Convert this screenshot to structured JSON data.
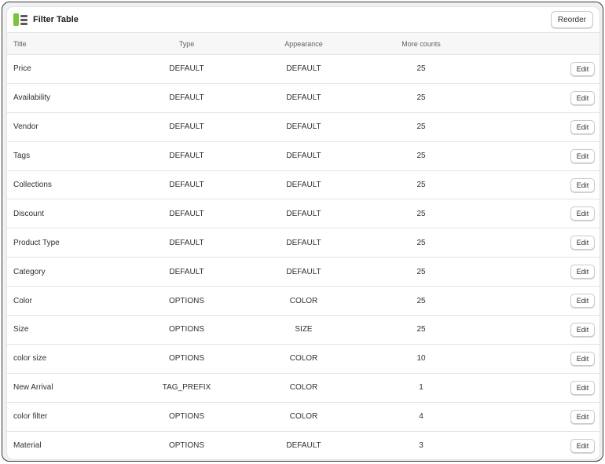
{
  "header": {
    "title": "Filter Table",
    "reorder_label": "Reorder",
    "icon": "filter-table-logo-icon"
  },
  "columns": {
    "title": "Title",
    "type": "Type",
    "appearance": "Appearance",
    "more_counts": "More counts"
  },
  "edit_label": "Edit",
  "colors": {
    "accent": "#7cc23b",
    "border": "#e3e3e3",
    "header_bg": "#f7f7f7"
  },
  "rows": [
    {
      "title": "Price",
      "type": "DEFAULT",
      "appearance": "DEFAULT",
      "more_counts": "25"
    },
    {
      "title": "Availability",
      "type": "DEFAULT",
      "appearance": "DEFAULT",
      "more_counts": "25"
    },
    {
      "title": "Vendor",
      "type": "DEFAULT",
      "appearance": "DEFAULT",
      "more_counts": "25"
    },
    {
      "title": "Tags",
      "type": "DEFAULT",
      "appearance": "DEFAULT",
      "more_counts": "25"
    },
    {
      "title": "Collections",
      "type": "DEFAULT",
      "appearance": "DEFAULT",
      "more_counts": "25"
    },
    {
      "title": "Discount",
      "type": "DEFAULT",
      "appearance": "DEFAULT",
      "more_counts": "25"
    },
    {
      "title": "Product Type",
      "type": "DEFAULT",
      "appearance": "DEFAULT",
      "more_counts": "25"
    },
    {
      "title": "Category",
      "type": "DEFAULT",
      "appearance": "DEFAULT",
      "more_counts": "25"
    },
    {
      "title": "Color",
      "type": "OPTIONS",
      "appearance": "COLOR",
      "more_counts": "25"
    },
    {
      "title": "Size",
      "type": "OPTIONS",
      "appearance": "SIZE",
      "more_counts": "25"
    },
    {
      "title": "color size",
      "type": "OPTIONS",
      "appearance": "COLOR",
      "more_counts": "10"
    },
    {
      "title": "New Arrival",
      "type": "TAG_PREFIX",
      "appearance": "COLOR",
      "more_counts": "1"
    },
    {
      "title": "color filter",
      "type": "OPTIONS",
      "appearance": "COLOR",
      "more_counts": "4"
    },
    {
      "title": "Material",
      "type": "OPTIONS",
      "appearance": "DEFAULT",
      "more_counts": "3"
    }
  ]
}
